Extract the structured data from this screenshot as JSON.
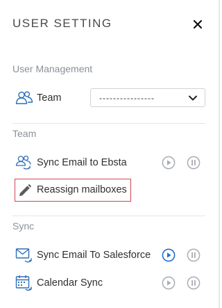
{
  "header": {
    "title": "USER SETTING",
    "close_icon": "close-icon"
  },
  "user_management": {
    "section_label": "User Management",
    "team": {
      "label": "Team",
      "icon": "users-icon",
      "select_value": "----------------"
    }
  },
  "team_section": {
    "section_label": "Team",
    "items": [
      {
        "label": "Sync Email to Ebsta",
        "icon": "users-sync-icon",
        "play_active": false
      },
      {
        "label": "Reassign mailboxes",
        "icon": "pencil-icon"
      }
    ]
  },
  "sync_section": {
    "section_label": "Sync",
    "items": [
      {
        "label": "Sync Email To Salesforce",
        "icon": "email-sync-icon",
        "play_active": true
      },
      {
        "label": "Calendar Sync",
        "icon": "calendar-sync-icon",
        "play_active": false
      }
    ]
  },
  "colors": {
    "accent_blue": "#1f6fd1",
    "icon_blue": "#2d6fb8",
    "control_grey": "#a9adb2",
    "highlight_red": "#d0454c",
    "section_grey": "#8a9099"
  }
}
